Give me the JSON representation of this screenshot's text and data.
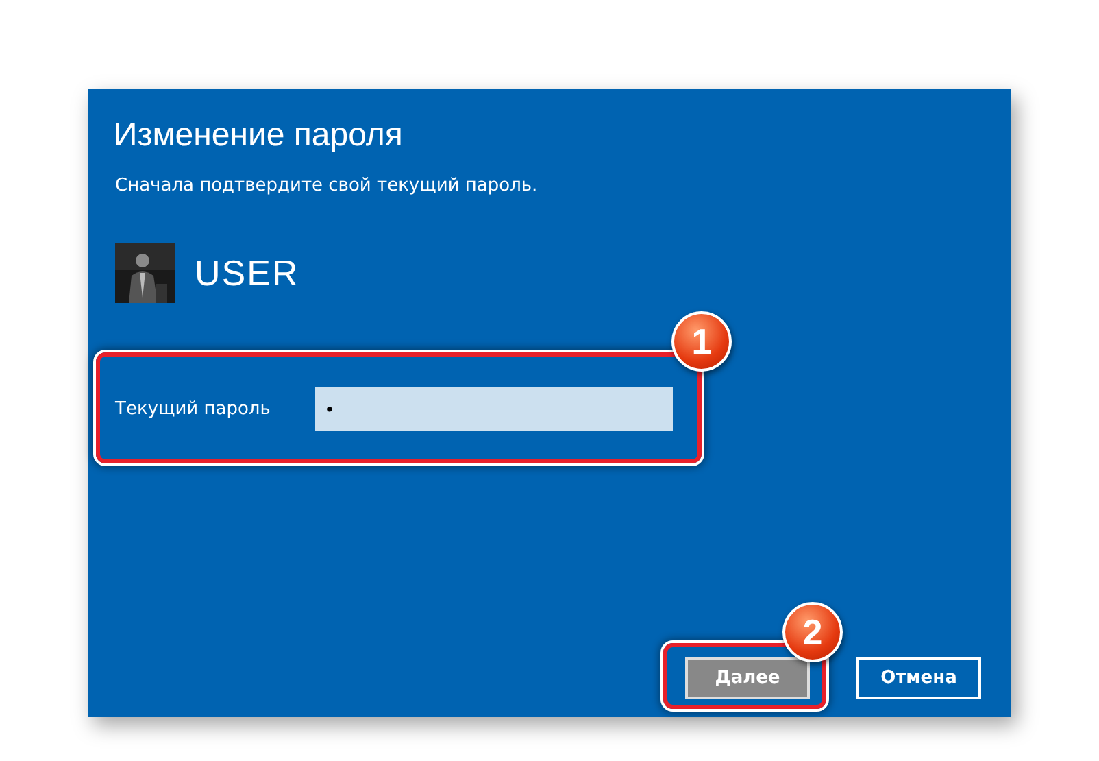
{
  "dialog": {
    "title": "Изменение пароля",
    "subtitle": "Сначала подтвердите свой текущий пароль.",
    "user": {
      "name": "USER"
    },
    "field": {
      "label": "Текущий пароль",
      "value": "•"
    },
    "buttons": [
      {
        "label": "Далее",
        "kind": "primary"
      },
      {
        "label": "Отмена",
        "kind": "secondary"
      }
    ]
  },
  "annotations": [
    {
      "number": "1"
    },
    {
      "number": "2"
    }
  ]
}
